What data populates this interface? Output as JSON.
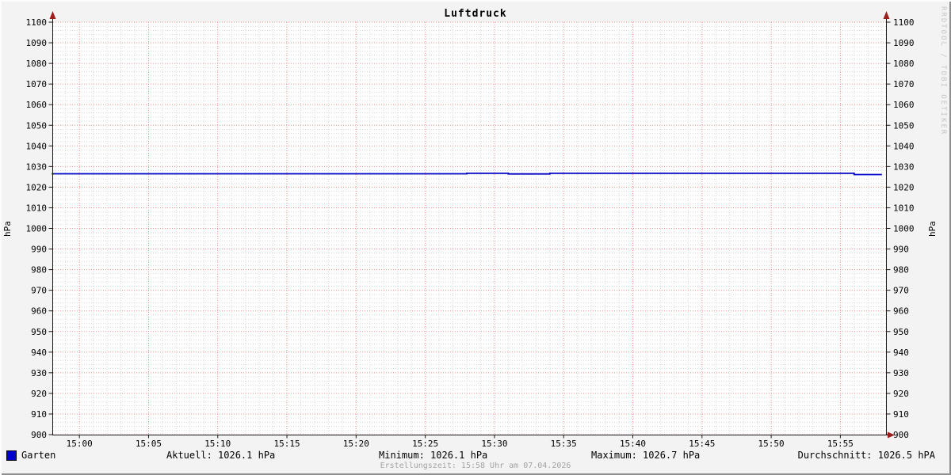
{
  "title": "Luftdruck",
  "watermark": "RRDTOOL / TOBI OETIKER",
  "footer": {
    "creation_text": "Erstellungszeit: 15:58 Uhr am 07.04.2026"
  },
  "legend": {
    "series_label": "Garten",
    "series_color": "#0000c8",
    "stats": [
      {
        "name": "aktuell",
        "text": "Aktuell: 1026.1 hPa"
      },
      {
        "name": "minimum",
        "text": "Minimum: 1026.1 hPa"
      },
      {
        "name": "maximum",
        "text": "Maximum: 1026.7 hPa"
      },
      {
        "name": "durchschnitt",
        "text": "Durchschnitt: 1026.5 hPA"
      }
    ]
  },
  "chart_data": {
    "type": "line",
    "title": "Luftdruck",
    "ylabel": "hPa",
    "ylabel_right": "hPa",
    "ylim": [
      900,
      1100
    ],
    "y_tick_step": 10,
    "y_minor_step": 2,
    "x_ticks": [
      "15:00",
      "15:05",
      "15:10",
      "15:15",
      "15:20",
      "15:25",
      "15:30",
      "15:35",
      "15:40",
      "15:45",
      "15:50",
      "15:55"
    ],
    "x_minor_step_min": 1,
    "xlim_minutes_from_1500": [
      -1.9,
      58.3
    ],
    "grid": true,
    "legend_position": "bottom",
    "colors": {
      "background": "#f3f3f3",
      "canvas": "#ffffff",
      "major_grid": "#eb9191",
      "minor_grid": "#d8d8d8",
      "axis": "#1a1a1a",
      "arrow": "#9c1f1f",
      "series": "#0000c8",
      "muted_text": "#a4a4a4",
      "watermark": "#c6c6c6"
    },
    "series": [
      {
        "name": "Garten",
        "color": "#0000c8",
        "unit": "hPa",
        "stats": {
          "aktuell": 1026.1,
          "minimum": 1026.1,
          "maximum": 1026.7,
          "durchschnitt": 1026.5
        },
        "points": [
          {
            "t": "14:58",
            "v": 1026.5
          },
          {
            "t": "15:28",
            "v": 1026.5
          },
          {
            "t": "15:28",
            "v": 1026.7
          },
          {
            "t": "15:31",
            "v": 1026.7
          },
          {
            "t": "15:31",
            "v": 1026.4
          },
          {
            "t": "15:34",
            "v": 1026.4
          },
          {
            "t": "15:34",
            "v": 1026.7
          },
          {
            "t": "15:56",
            "v": 1026.7
          },
          {
            "t": "15:56",
            "v": 1026.1
          },
          {
            "t": "15:58",
            "v": 1026.1
          }
        ]
      }
    ]
  }
}
